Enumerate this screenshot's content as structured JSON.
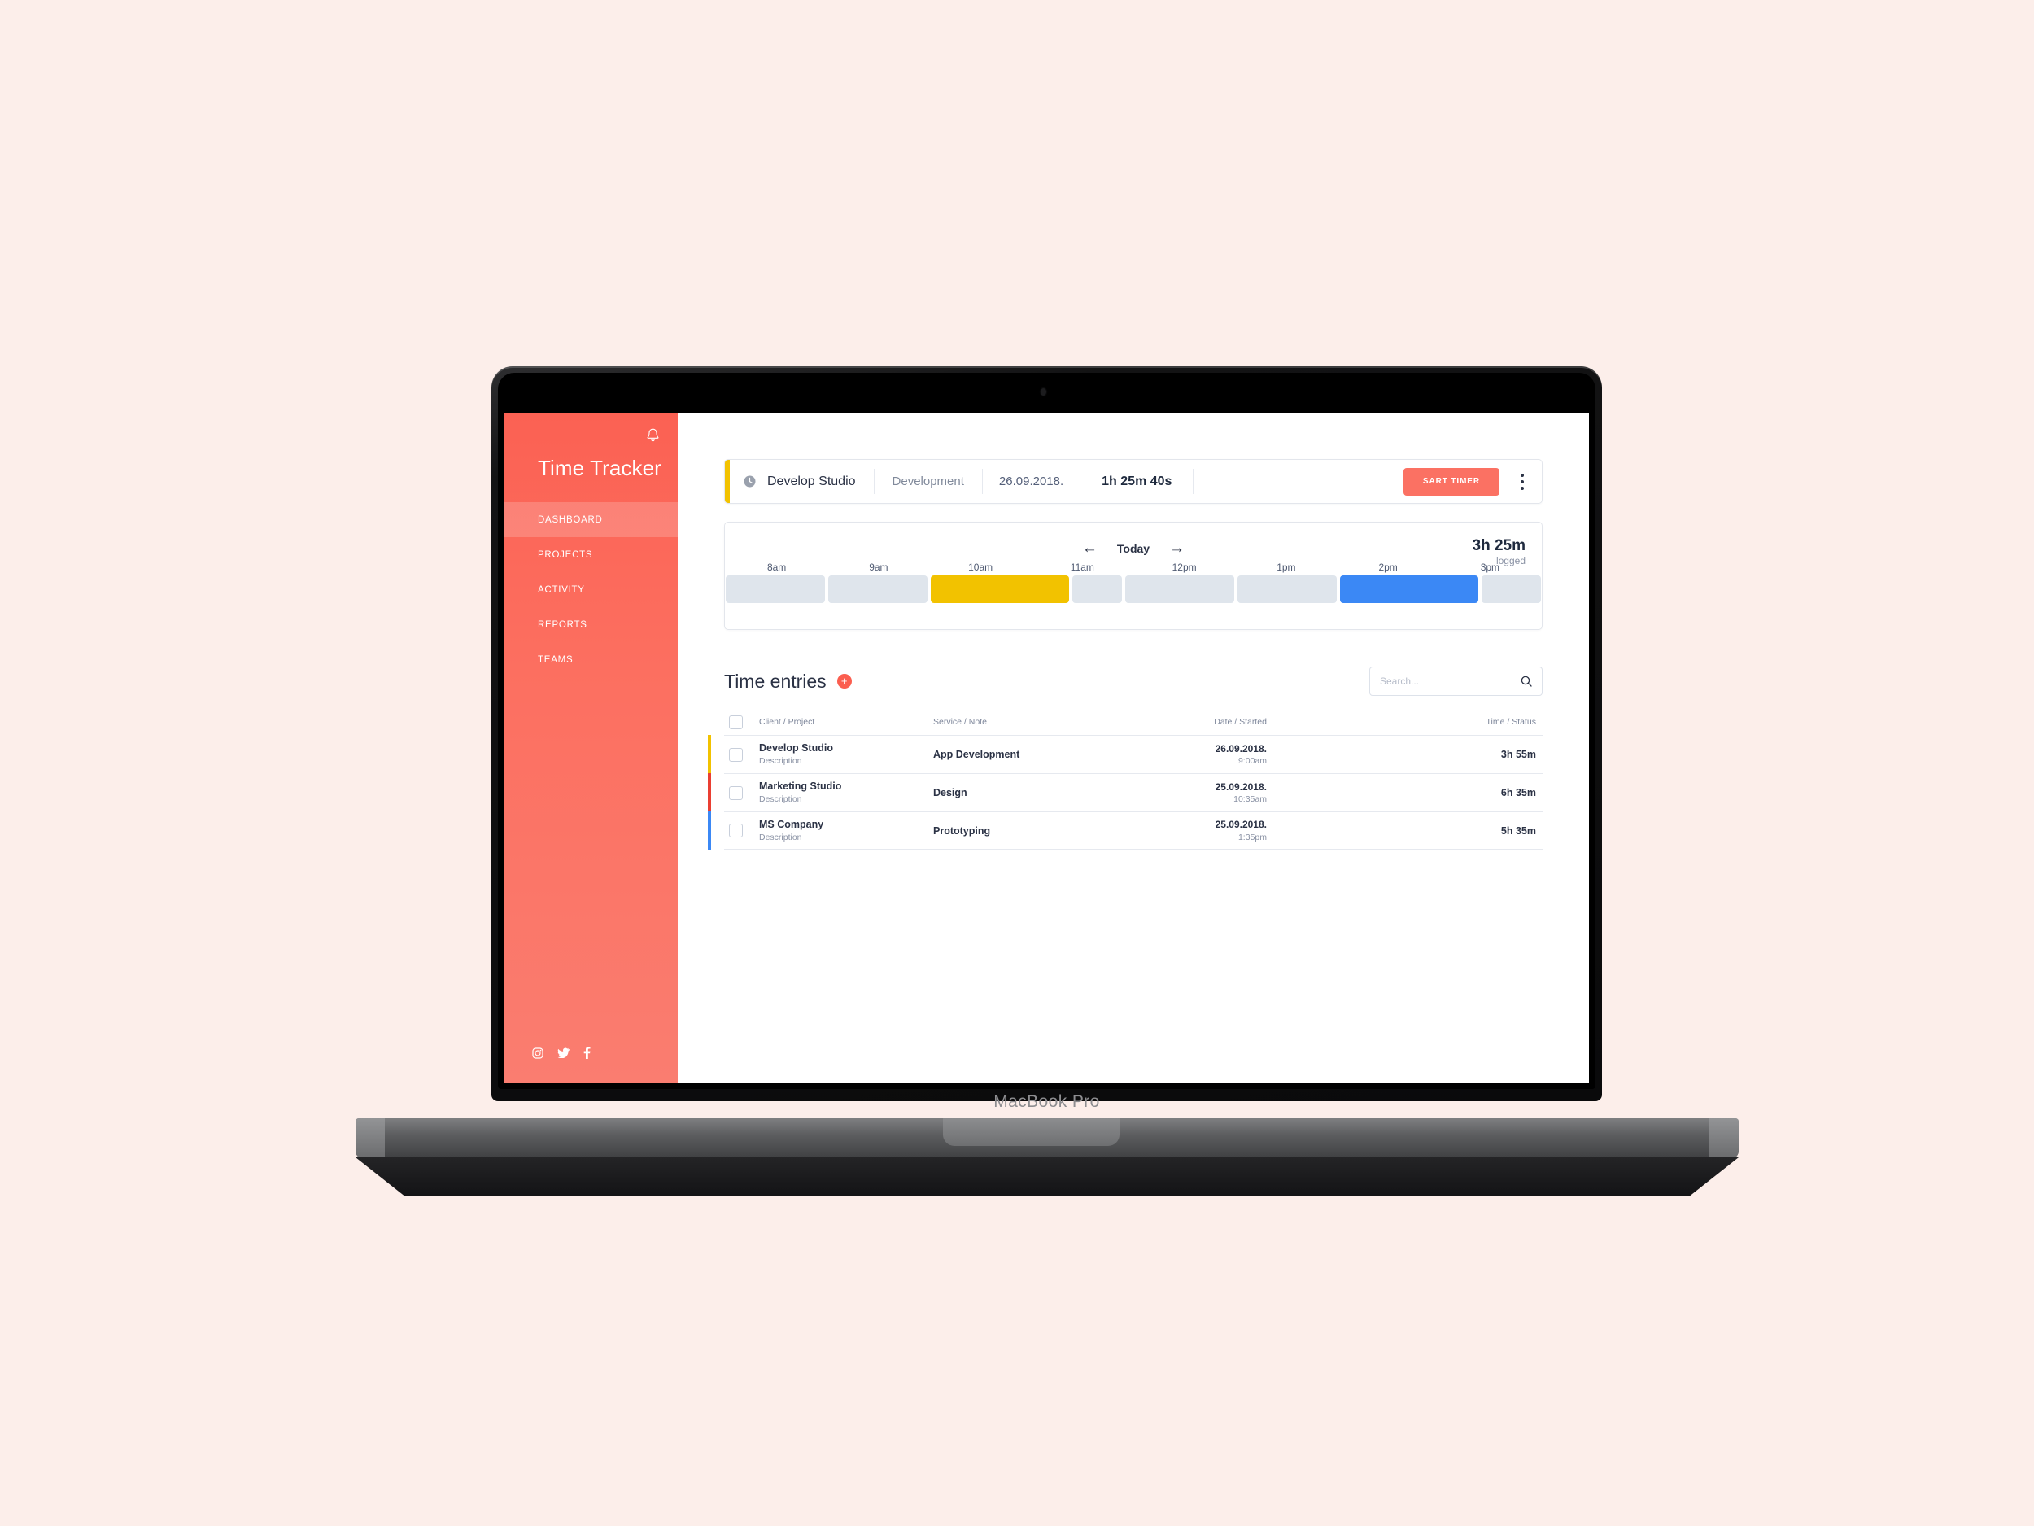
{
  "page": {
    "background_color": "#FCEEEA",
    "device_label": "MacBook Pro"
  },
  "sidebar": {
    "app_title": "Time Tracker",
    "bell_icon": "bell-icon",
    "accent_color": "#FB6153",
    "items": [
      {
        "label": "DASHBOARD",
        "active": true
      },
      {
        "label": "PROJECTS",
        "active": false
      },
      {
        "label": "ACTIVITY",
        "active": false
      },
      {
        "label": "REPORTS",
        "active": false
      },
      {
        "label": "TEAMS",
        "active": false
      }
    ],
    "social": [
      {
        "name": "instagram-icon"
      },
      {
        "name": "twitter-icon"
      },
      {
        "name": "facebook-icon"
      }
    ]
  },
  "timer_bar": {
    "accent_color": "#F2C200",
    "clock_icon": "clock-icon",
    "project": "Develop Studio",
    "service": "Development",
    "date": "26.09.2018.",
    "elapsed": "1h 25m 40s",
    "start_button_label": "SART TIMER",
    "start_button_color": "#FB7163",
    "menu_icon": "more-vertical-icon"
  },
  "timeline": {
    "prev_icon": "arrow-left-icon",
    "next_icon": "arrow-right-icon",
    "today_label": "Today",
    "total_value": "3h 25m",
    "total_label": "logged",
    "hours": [
      "8am",
      "9am",
      "10am",
      "11am",
      "12pm",
      "1pm",
      "2pm",
      "3pm"
    ],
    "slot_empty_color": "#dfe5ec",
    "segments": [
      {
        "start": 0,
        "span": 1,
        "color": "#dfe5ec",
        "filled": false
      },
      {
        "start": 1,
        "span": 1,
        "color": "#dfe5ec",
        "filled": false
      },
      {
        "start": 2,
        "span": 1.4,
        "color": "#F2C200",
        "filled": true
      },
      {
        "start": 3.4,
        "span": 0.5,
        "color": "#dfe5ec",
        "filled": false
      },
      {
        "start": 3.9,
        "span": 1.1,
        "color": "#dfe5ec",
        "filled": false
      },
      {
        "start": 5.0,
        "span": 1.0,
        "color": "#dfe5ec",
        "filled": false
      },
      {
        "start": 6.0,
        "span": 1.4,
        "color": "#3B88F5",
        "filled": true
      },
      {
        "start": 7.4,
        "span": 0.6,
        "color": "#dfe5ec",
        "filled": false
      }
    ]
  },
  "entries": {
    "title": "Time entries",
    "add_button_label": "+",
    "search": {
      "placeholder": "Search...",
      "value": "",
      "icon": "search-icon"
    },
    "columns": {
      "client": "Client / Project",
      "service": "Service / Note",
      "date": "Date / Started",
      "time": "Time / Status"
    },
    "rows": [
      {
        "accent_color": "#F2C200",
        "client": "Develop Studio",
        "description": "Description",
        "service": "App Development",
        "date": "26.09.2018.",
        "started": "9:00am",
        "time": "3h 55m"
      },
      {
        "accent_color": "#EA3F32",
        "client": "Marketing Studio",
        "description": "Description",
        "service": "Design",
        "date": "25.09.2018.",
        "started": "10:35am",
        "time": "6h 35m"
      },
      {
        "accent_color": "#3B88F5",
        "client": "MS Company",
        "description": "Description",
        "service": "Prototyping",
        "date": "25.09.2018.",
        "started": "1:35pm",
        "time": "5h 35m"
      }
    ]
  }
}
